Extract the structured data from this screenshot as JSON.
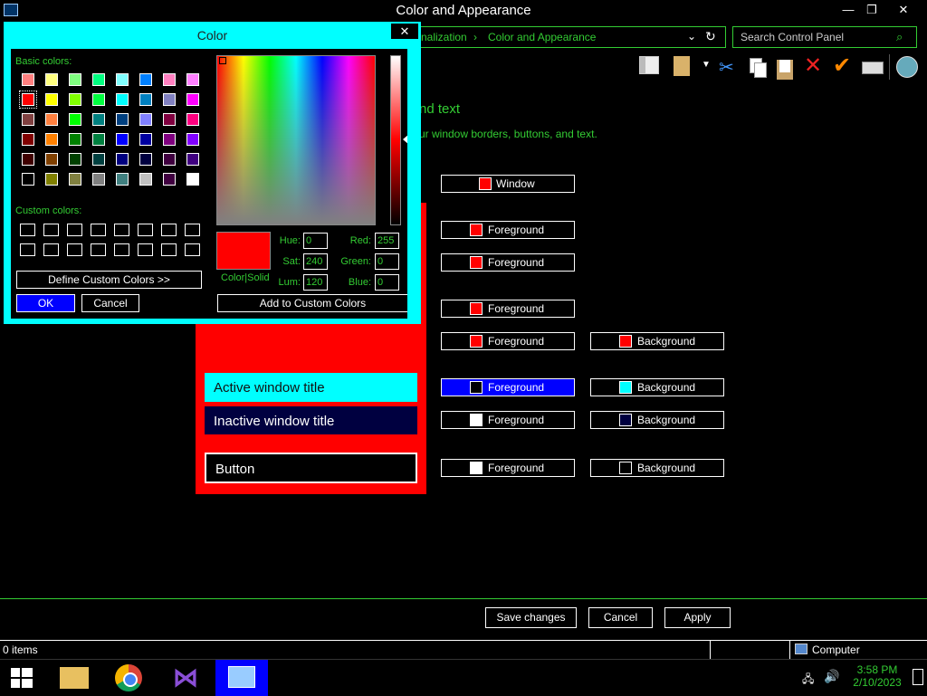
{
  "window": {
    "title": "Color and Appearance",
    "minimize": "—",
    "restore": "❐",
    "close": "✕"
  },
  "address": {
    "crumbs": [
      "nalization",
      "Color and Appearance"
    ],
    "separator": "›"
  },
  "search": {
    "placeholder": "Search Control Panel"
  },
  "heading": {
    "title_fragment": "nd text",
    "subtitle_fragment": "ur window borders, buttons, and text."
  },
  "items": {
    "window_label": "Window",
    "fg1": "Foreground",
    "fg2": "Foreground",
    "fg3": "Foreground",
    "fg4": "Foreground",
    "bg4": "Background",
    "fg5": "Foreground",
    "bg5": "Background",
    "fg6": "Foreground",
    "bg6": "Background",
    "fg7": "Foreground",
    "bg7": "Background"
  },
  "preview": {
    "active_title": "Active window title",
    "inactive_title": "Inactive window title",
    "button": "Button"
  },
  "dialog": {
    "title": "Color",
    "close": "✕",
    "basic_colors_label": "Basic colors:",
    "custom_colors_label": "Custom colors:",
    "define_custom": "Define Custom Colors >>",
    "ok": "OK",
    "cancel": "Cancel",
    "color_solid": "Color|Solid",
    "add_custom": "Add to Custom Colors",
    "hue_label": "Hue:",
    "hue": "0",
    "sat_label": "Sat:",
    "sat": "240",
    "lum_label": "Lum:",
    "lum": "120",
    "red_label": "Red:",
    "red": "255",
    "green_label": "Green:",
    "green": "0",
    "blue_label": "Blue:",
    "blue": "0",
    "basic_colors": [
      [
        "#ff8080",
        "#ffff80",
        "#80ff80",
        "#00ff80",
        "#80ffff",
        "#0080ff",
        "#ff80c0",
        "#ff80ff"
      ],
      [
        "#ff0000",
        "#ffff00",
        "#80ff00",
        "#00ff40",
        "#00ffff",
        "#0080c0",
        "#8080c0",
        "#ff00ff"
      ],
      [
        "#804040",
        "#ff8040",
        "#00ff00",
        "#008080",
        "#004080",
        "#8080ff",
        "#800040",
        "#ff0080"
      ],
      [
        "#800000",
        "#ff8000",
        "#008000",
        "#008040",
        "#0000ff",
        "#0000a0",
        "#800080",
        "#8000ff"
      ],
      [
        "#400000",
        "#804000",
        "#004000",
        "#004040",
        "#000080",
        "#000040",
        "#400040",
        "#400080"
      ],
      [
        "#000000",
        "#808000",
        "#808040",
        "#808080",
        "#408080",
        "#c0c0c0",
        "#400040",
        "#ffffff"
      ]
    ]
  },
  "footer": {
    "save": "Save changes",
    "cancel": "Cancel",
    "apply": "Apply"
  },
  "status": {
    "items": "0 items",
    "computer": "Computer"
  },
  "clock": {
    "time": "3:58 PM",
    "date": "2/10/2023"
  }
}
